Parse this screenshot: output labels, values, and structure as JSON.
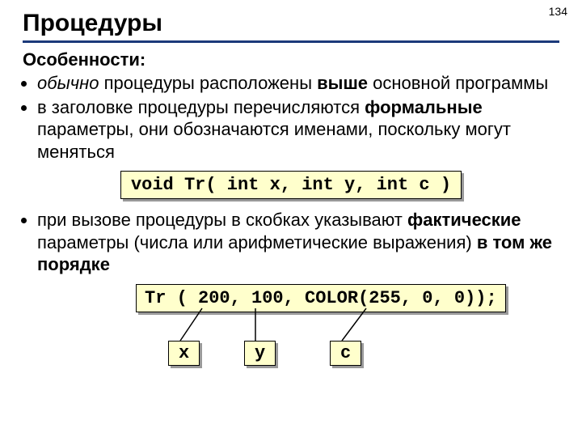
{
  "page_number": "134",
  "title": "Процедуры",
  "subtitle": "Особенности:",
  "bullets": {
    "b1_prefix_italic": "обычно",
    "b1_mid": " процедуры расположены ",
    "b1_bold": "выше",
    "b1_end": " основной программы",
    "b2_prefix": "в заголовке процедуры перечисляются ",
    "b2_bold": "формальные",
    "b2_end": " параметры, они обозначаются именами, поскольку могут меняться",
    "b3_prefix": "при вызове процедуры в скобках указывают ",
    "b3_bold1": "фактические",
    "b3_mid": " параметры (числа или арифметические выражения) ",
    "b3_bold2": "в том же порядке"
  },
  "code_decl": "void Tr( int x, int y, int c )",
  "code_call": "Tr ( 200, 100, COLOR(255, 0, 0));",
  "vars": {
    "x": "x",
    "y": "y",
    "c": "c"
  }
}
